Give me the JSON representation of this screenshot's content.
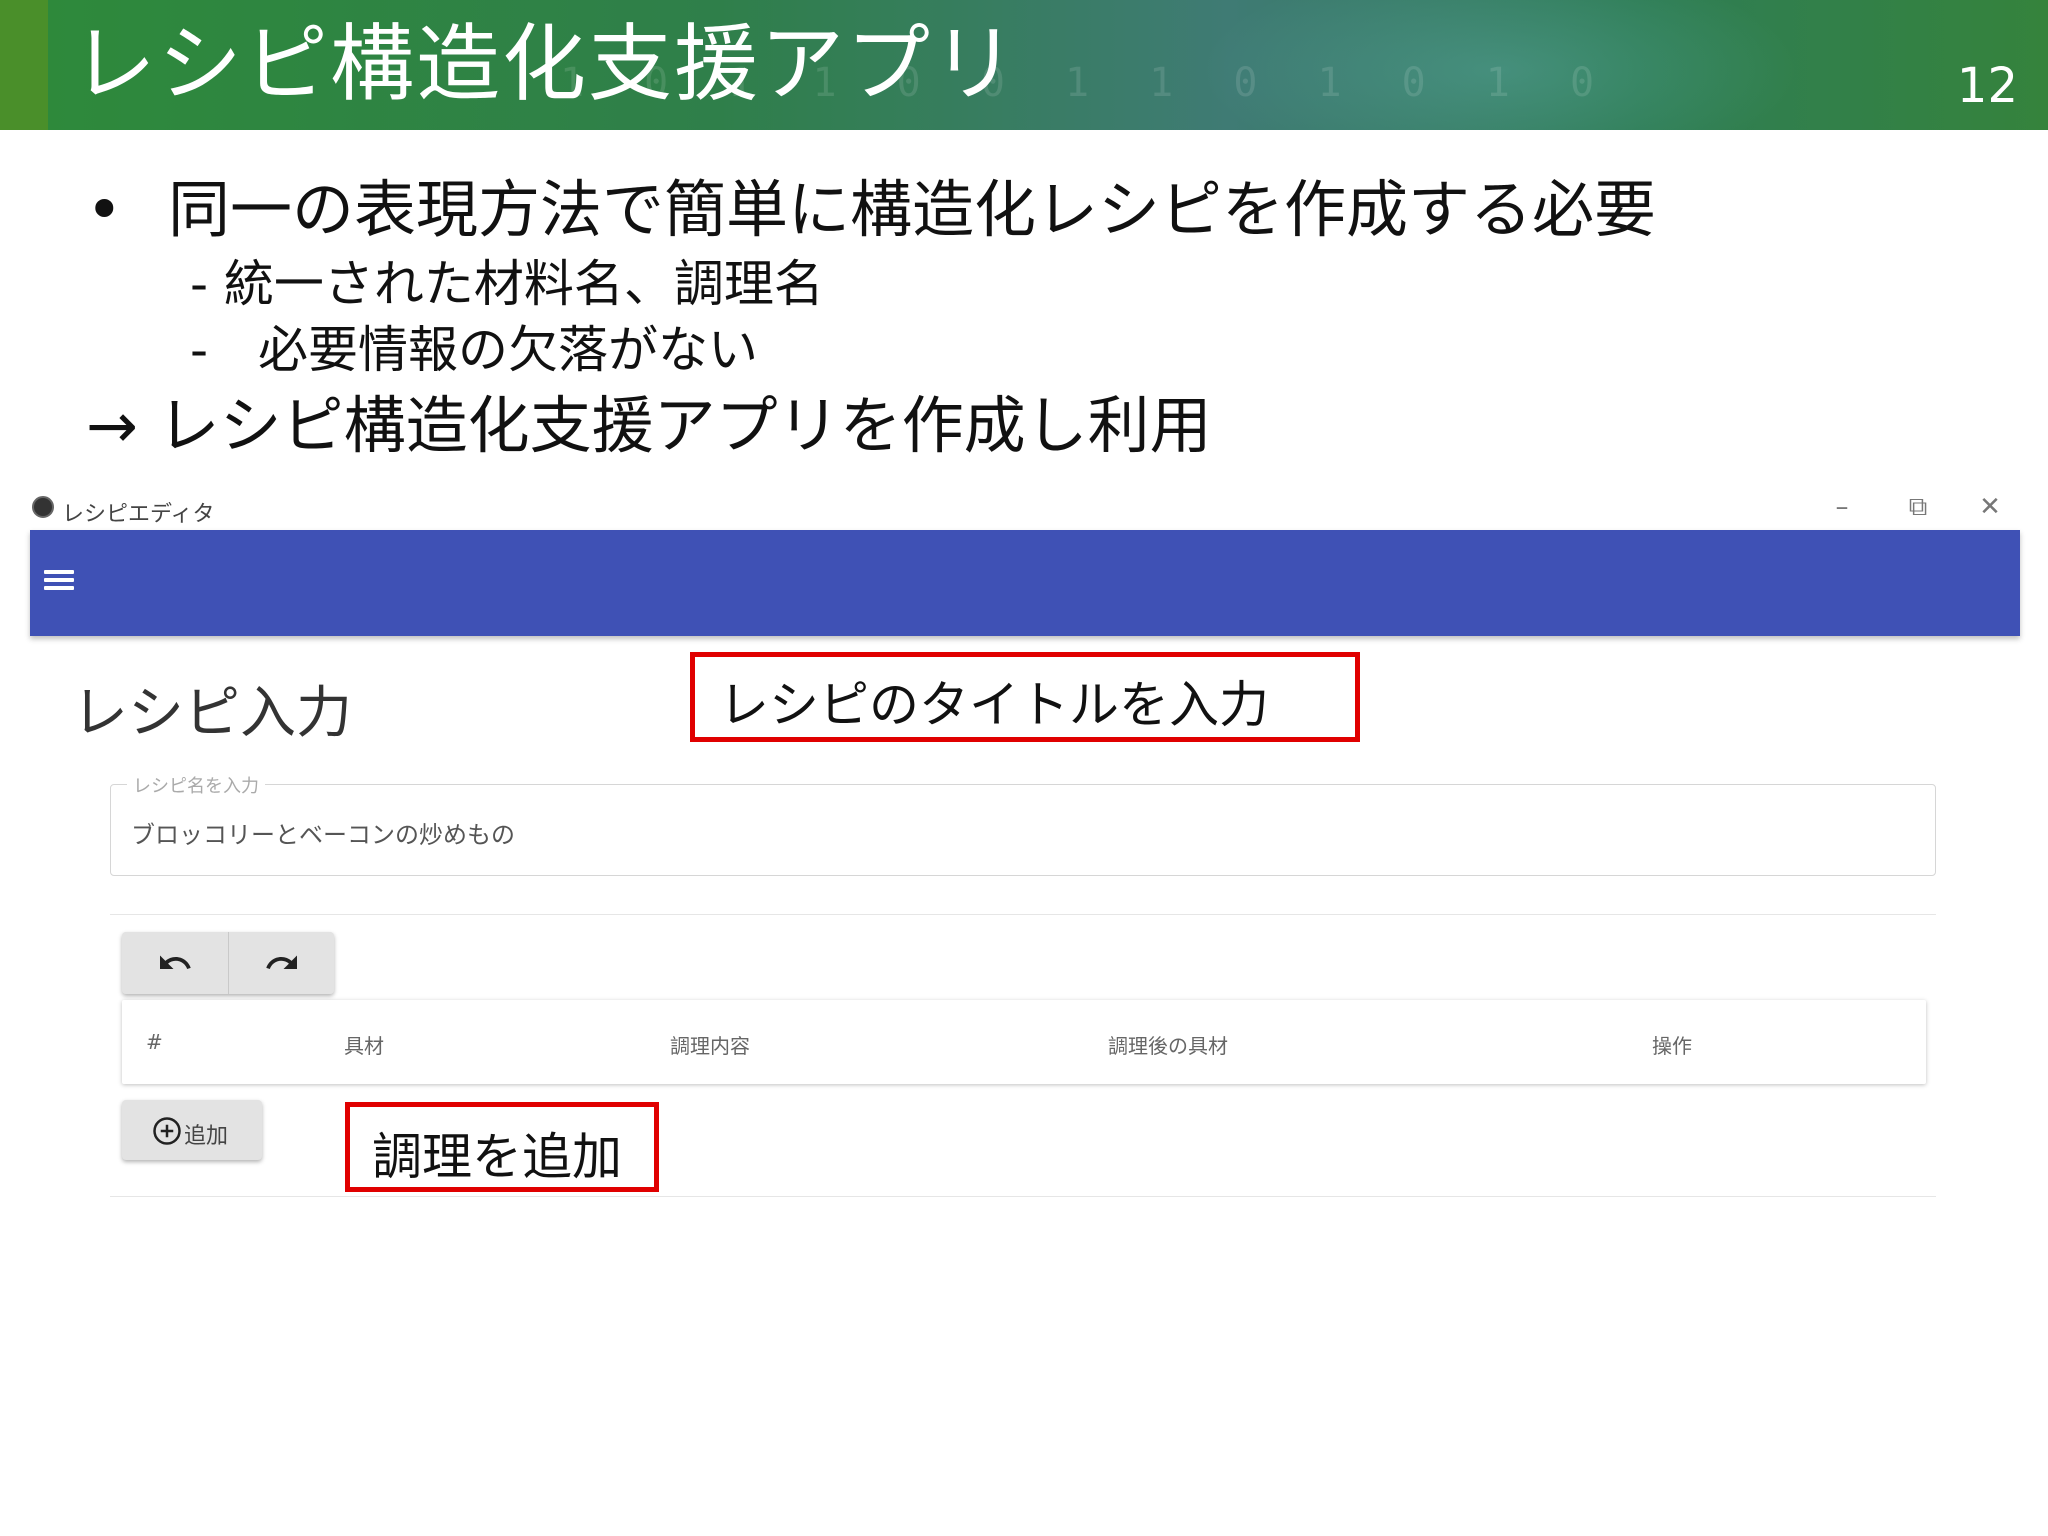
{
  "slide": {
    "title": "レシピ構造化支援アプリ",
    "page_number": "12",
    "bullet_symbol": "•",
    "bullet_main": "同一の表現方法で簡単に構造化レシピを作成する必要",
    "sub_points": [
      "- 統一された材料名、調理名",
      "-　必要情報の欠落がない"
    ],
    "conclusion": "→ レシピ構造化支援アプリを作成し利用"
  },
  "app": {
    "window_title": "レシピエディタ",
    "controls": {
      "minimize": "–",
      "restore": "⧉",
      "close": "✕"
    },
    "page_heading": "レシピ入力",
    "title_field": {
      "label": "レシピ名を入力",
      "value": "ブロッコリーとベーコンの炒めもの"
    },
    "table_headers": [
      "#",
      "具材",
      "調理内容",
      "調理後の具材",
      "操作"
    ],
    "add_button_label": "追加"
  },
  "annotations": {
    "title_callout": "レシピのタイトルを入力",
    "add_callout": "調理を追加",
    "border_color": "#e00000"
  },
  "colors": {
    "app_bar": "#3f51b5",
    "header_green": "#2e8a3a"
  },
  "icons": {
    "menu": "hamburger-menu-icon",
    "undo": "undo-icon",
    "redo": "redo-icon",
    "add": "add-circle-icon"
  }
}
